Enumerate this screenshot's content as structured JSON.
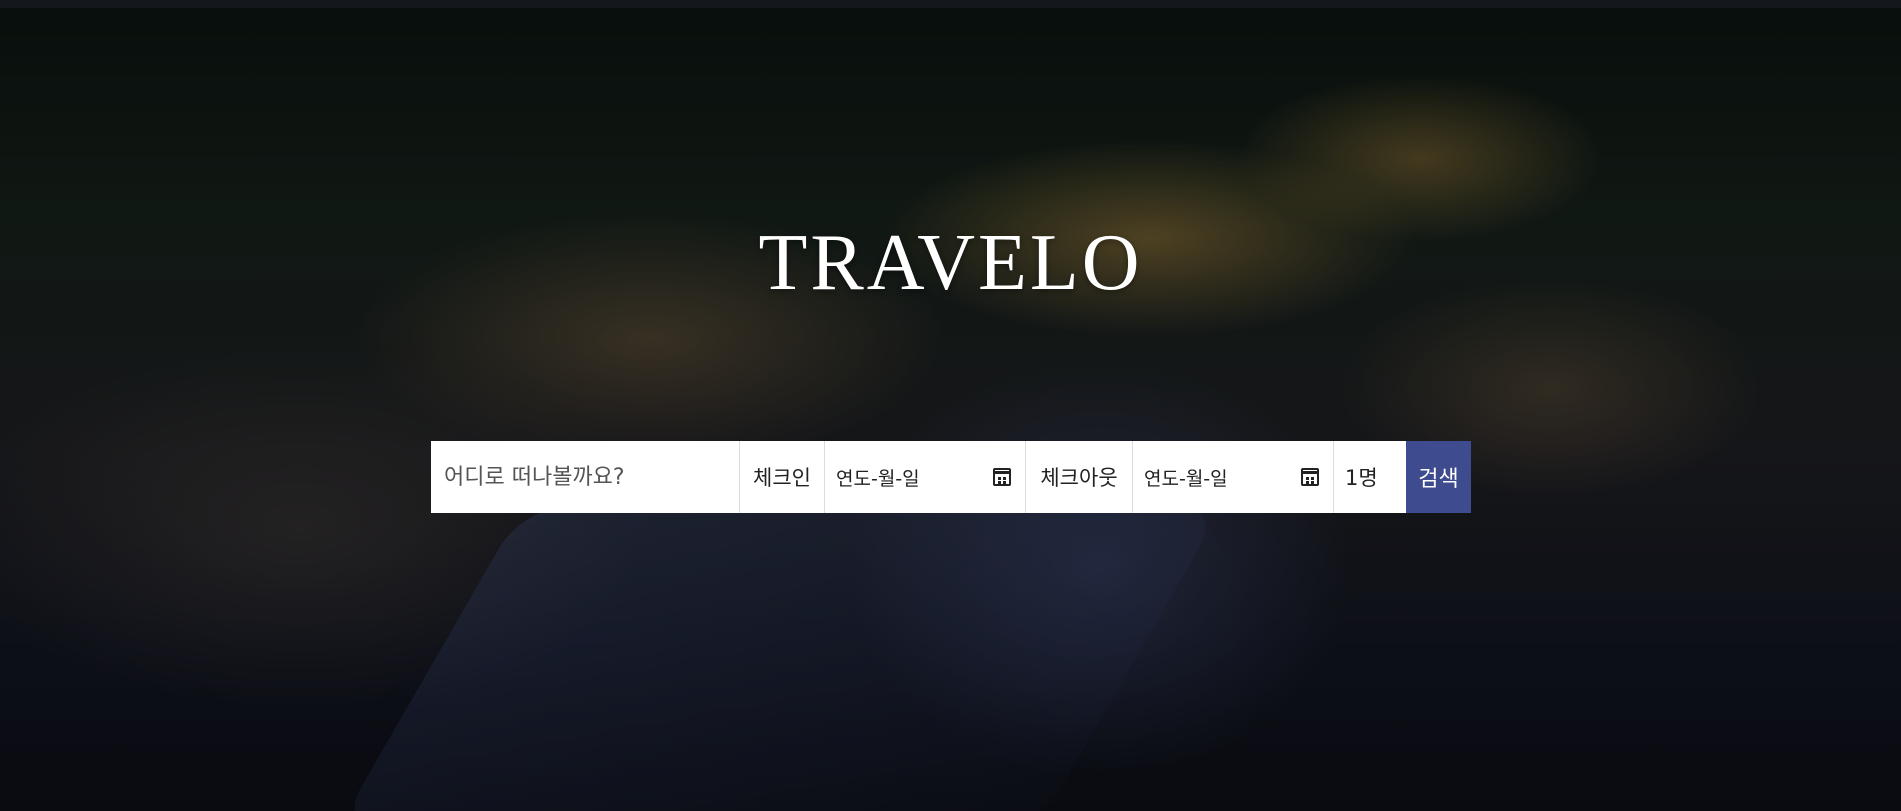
{
  "hero": {
    "title": "TRAVELO"
  },
  "search": {
    "destination_placeholder": "어디로 떠나볼까요?",
    "checkin_label": "체크인",
    "checkin_date": "연도-월-일",
    "checkout_label": "체크아웃",
    "checkout_date": "연도-월-일",
    "guests": "1명",
    "button_label": "검색"
  },
  "colors": {
    "search_button": "#3f4b8f",
    "title": "#ffffff"
  },
  "icons": {
    "date_picker": "calendar-icon"
  }
}
